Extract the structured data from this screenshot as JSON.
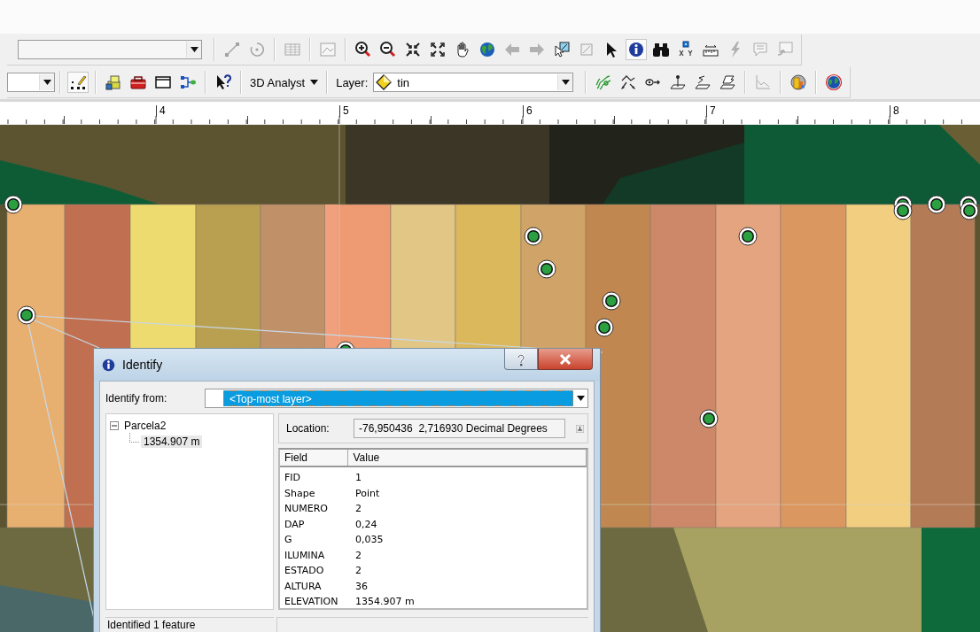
{
  "toolbar_row_1": {
    "groups": [
      [
        {
          "kind": "line",
          "disabled": true,
          "selected": false
        },
        {
          "kind": "rotate",
          "disabled": true,
          "selected": false
        }
      ],
      [
        {
          "kind": "table",
          "disabled": true,
          "selected": false
        }
      ],
      [
        {
          "kind": "picture",
          "disabled": true,
          "selected": false
        }
      ],
      [
        {
          "kind": "zoom-in",
          "disabled": false,
          "selected": false
        },
        {
          "kind": "zoom-out",
          "disabled": false,
          "selected": false
        },
        {
          "kind": "fixed-zoom-in",
          "disabled": false,
          "selected": false
        },
        {
          "kind": "fixed-zoom-out",
          "disabled": false,
          "selected": false
        },
        {
          "kind": "pan",
          "disabled": false,
          "selected": false
        },
        {
          "kind": "globe",
          "disabled": false,
          "selected": false
        },
        {
          "kind": "back",
          "disabled": true,
          "selected": false
        },
        {
          "kind": "forward",
          "disabled": true,
          "selected": false
        },
        {
          "kind": "select",
          "disabled": false,
          "selected": false
        },
        {
          "kind": "clear",
          "disabled": true,
          "selected": false
        },
        {
          "kind": "pointer",
          "disabled": false,
          "selected": false
        },
        {
          "kind": "identify",
          "disabled": false,
          "selected": true
        },
        {
          "kind": "find",
          "disabled": false,
          "selected": false
        },
        {
          "kind": "goto-xy",
          "disabled": false,
          "selected": false
        },
        {
          "kind": "measure",
          "disabled": false,
          "selected": false
        },
        {
          "kind": "lightning",
          "disabled": true,
          "selected": false
        },
        {
          "kind": "popup",
          "disabled": true,
          "selected": false
        },
        {
          "kind": "window-arrow",
          "disabled": true,
          "selected": false
        }
      ]
    ]
  },
  "toolbar_row_2": {
    "groups_before": [
      [
        {
          "kind": "edit",
          "disabled": false,
          "selected": true
        }
      ],
      [
        {
          "kind": "add-data",
          "disabled": false,
          "selected": false
        },
        {
          "kind": "toolbox",
          "disabled": false,
          "selected": false
        },
        {
          "kind": "window",
          "disabled": false,
          "selected": false
        },
        {
          "kind": "model",
          "disabled": false,
          "selected": false
        }
      ],
      [
        {
          "kind": "whats-this",
          "disabled": false,
          "selected": false
        }
      ]
    ],
    "menu": {
      "label": "3D Analyst"
    },
    "layer": {
      "label": "Layer:",
      "value": "tin"
    },
    "groups_after": [
      [
        {
          "kind": "contour",
          "disabled": false,
          "selected": false
        },
        {
          "kind": "steepest",
          "disabled": false,
          "selected": false
        },
        {
          "kind": "sight",
          "disabled": false,
          "selected": false
        },
        {
          "kind": "point-plane",
          "disabled": false,
          "selected": false
        },
        {
          "kind": "line-plane",
          "disabled": false,
          "selected": false
        },
        {
          "kind": "shape-plane",
          "disabled": false,
          "selected": false
        }
      ],
      [
        {
          "kind": "graph",
          "disabled": true,
          "selected": false
        }
      ],
      [
        {
          "kind": "scene",
          "disabled": false,
          "selected": false
        }
      ],
      [
        {
          "kind": "globe-view",
          "disabled": false,
          "selected": false
        }
      ]
    ]
  },
  "ruler": {
    "labels": [
      "4",
      "5",
      "6",
      "7",
      "8"
    ]
  },
  "identify_dialog": {
    "title": "Identify",
    "identify_from": {
      "label": "Identify from:",
      "value": "<Top-most layer>"
    },
    "tree": [
      {
        "label": "Parcela2",
        "expanded": true,
        "selected": false,
        "children": [
          {
            "label": "1354.907 m",
            "selected": true
          }
        ]
      }
    ],
    "location": {
      "label": "Location:",
      "value": "-76,950436  2,716930 Decimal Degrees"
    },
    "table": {
      "columns": [
        "Field",
        "Value"
      ],
      "rows": [
        [
          "FID",
          "1"
        ],
        [
          "Shape",
          "Point"
        ],
        [
          "NUMERO",
          "2"
        ],
        [
          "DAP",
          "0,24"
        ],
        [
          "G",
          "0,035"
        ],
        [
          "ILUMINA",
          "2"
        ],
        [
          "ESTADO",
          "2"
        ],
        [
          "ALTURA",
          "36"
        ],
        [
          "ELEVATION",
          "1354.907 m"
        ]
      ]
    },
    "status": "Identified 1 feature"
  }
}
